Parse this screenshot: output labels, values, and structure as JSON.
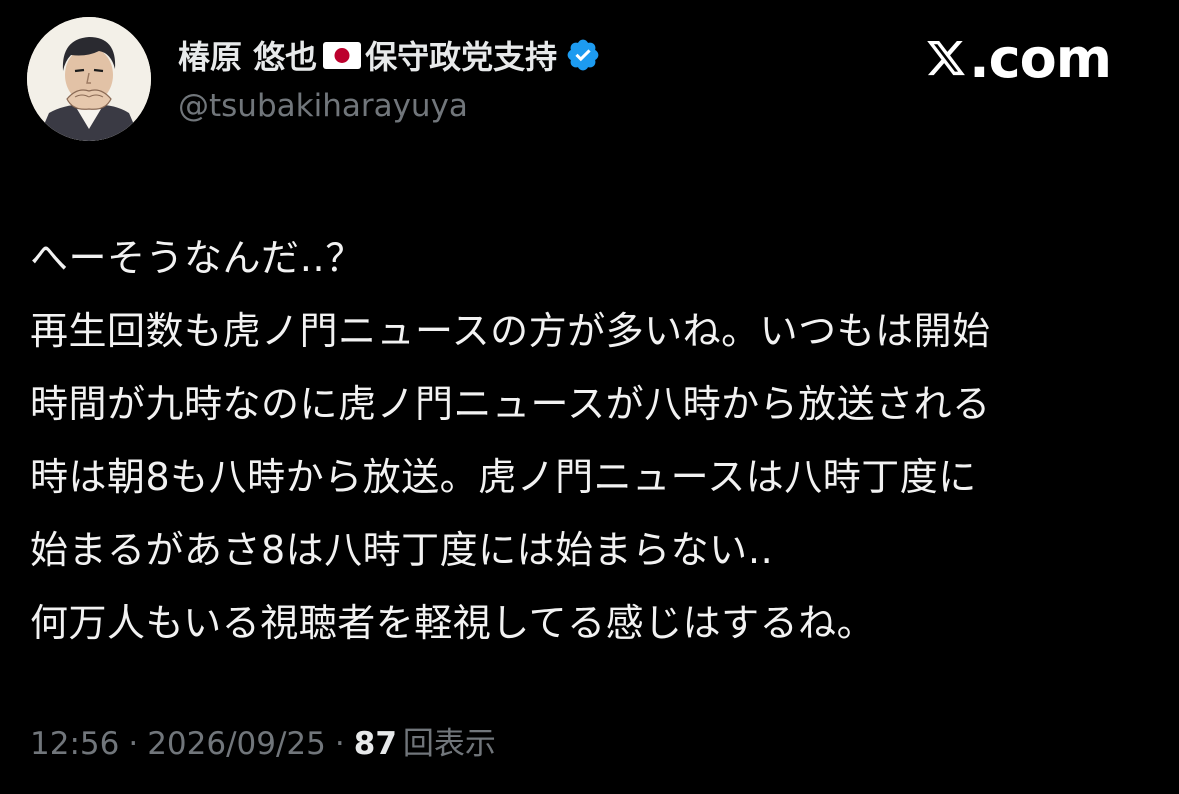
{
  "profile": {
    "display_name": "椿原 悠也",
    "flag_emoji": "🇯🇵",
    "name_suffix": "保守政党支持",
    "verified": true,
    "handle": "@tsubakiharayuya",
    "avatar_icon": "avatar-illustrated-man-icon"
  },
  "brand": {
    "label": ".com",
    "logo_icon": "x-logo-icon"
  },
  "tweet": {
    "lines": [
      "へーそうなんだ‥？",
      "再生回数も虎ノ門ニュースの方が多いね。いつもは開始",
      "時間が九時なのに虎ノ門ニュースが八時から放送される",
      "時は朝8も八時から放送。虎ノ門ニュースは八時丁度に",
      "始まるがあさ8は八時丁度には始まらない‥",
      "何万人もいる視聴者を軽視してる感じはするね。"
    ]
  },
  "meta": {
    "time": "12:56",
    "separator": "·",
    "date": "2026/09/25",
    "views_count": "87",
    "views_label": "回表示"
  },
  "colors": {
    "background": "#000000",
    "primary_text": "#e7e9ea",
    "secondary_text": "#71767b",
    "verified_blue": "#1d9bf0",
    "flag_red": "#bc002d"
  }
}
